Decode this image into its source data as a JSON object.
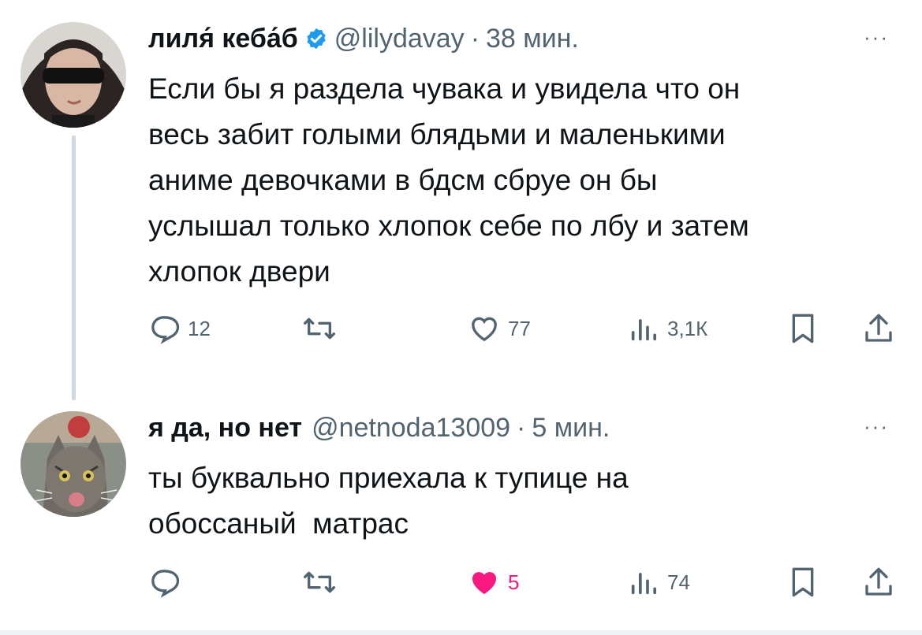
{
  "tweet1": {
    "display_name": "лиля́ кеба́б",
    "handle": "@lilydavay",
    "separator": "·",
    "time": "38 мин.",
    "more": "···",
    "text_lines": [
      "Если бы я раздела чувака и увидела что он",
      "весь забит голыми блядьми и маленькими",
      "аниме девочками в бдсм сбруе он бы",
      "услышал только хлопок себе по лбу и затем",
      "хлопок двери"
    ],
    "replies": "12",
    "likes": "77",
    "views": "3,1К"
  },
  "tweet2": {
    "display_name": "я да, но нет",
    "handle": "@netnoda13009",
    "separator": "·",
    "time": "5 мин.",
    "more": "···",
    "text_lines": [
      "ты буквально приехала к тупице на",
      "обоссаный  матрас"
    ],
    "likes": "5",
    "views": "74"
  },
  "colors": {
    "verified": "#1d9bf0",
    "liked": "#f91880",
    "muted": "#536471"
  }
}
